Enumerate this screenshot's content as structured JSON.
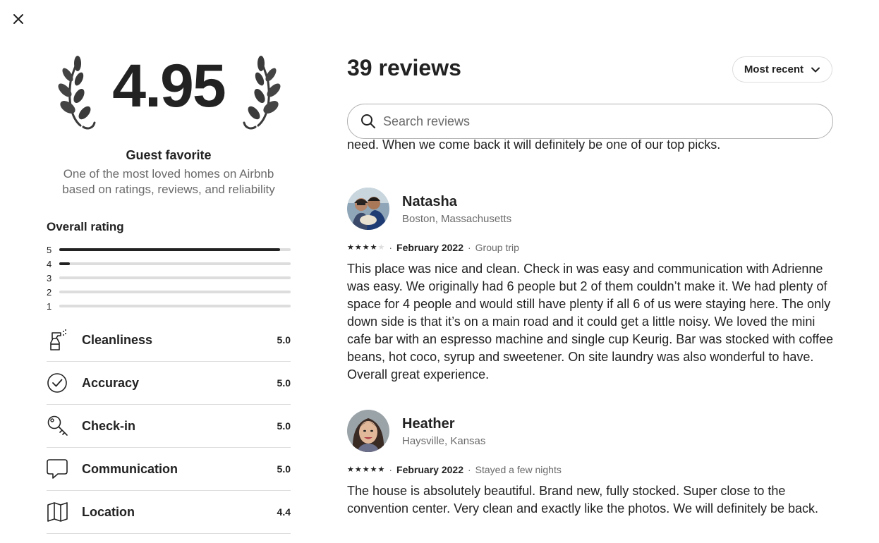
{
  "close": {
    "label": "Close"
  },
  "summary": {
    "rating": "4.95",
    "badge_title": "Guest favorite",
    "badge_desc": "One of the most loved homes on Airbnb based on ratings, reviews, and reliability"
  },
  "overall": {
    "title": "Overall rating",
    "distribution": [
      {
        "stars": "5",
        "fraction": 0.955
      },
      {
        "stars": "4",
        "fraction": 0.045
      },
      {
        "stars": "3",
        "fraction": 0
      },
      {
        "stars": "2",
        "fraction": 0
      },
      {
        "stars": "1",
        "fraction": 0
      }
    ]
  },
  "categories": [
    {
      "label": "Cleanliness",
      "score": "5.0",
      "icon": "spray-bottle-icon"
    },
    {
      "label": "Accuracy",
      "score": "5.0",
      "icon": "check-circle-icon"
    },
    {
      "label": "Check-in",
      "score": "5.0",
      "icon": "key-icon"
    },
    {
      "label": "Communication",
      "score": "5.0",
      "icon": "message-icon"
    },
    {
      "label": "Location",
      "score": "4.4",
      "icon": "map-icon"
    }
  ],
  "reviews_header": {
    "count_label": "39 reviews",
    "sort_label": "Most recent"
  },
  "search": {
    "placeholder": "Search reviews"
  },
  "previous_review_tail": "need. When we come back it will definitely be one of our top picks.",
  "reviews": [
    {
      "name": "Natasha",
      "location": "Boston, Massachusetts",
      "rating": 4,
      "date": "February 2022",
      "trip_type": "Group trip",
      "text": "This place was nice and clean. Check in was easy and communication with Adrienne was easy. We originally had 6 people but 2 of them couldn’t make it. We had plenty of space for 4 people and would still have plenty if all 6 of us were staying here. The only down side is that it’s on a main road and it could get a little noisy. We loved the mini cafe bar with an espresso machine and single cup Keurig. Bar was stocked with coffee beans, hot coco, syrup and sweetener. On site laundry was also wonderful to have. Overall great experience."
    },
    {
      "name": "Heather",
      "location": "Haysville, Kansas",
      "rating": 5,
      "date": "February 2022",
      "trip_type": "Stayed a few nights",
      "text": "The house is absolutely beautiful. Brand new, fully stocked. Super close to the convention center. Very clean and exactly like the photos. We will definitely be back."
    }
  ],
  "colors": {
    "text": "#222222",
    "muted": "#6a6a6a",
    "divider": "#dddddd",
    "track": "#dddddd"
  }
}
